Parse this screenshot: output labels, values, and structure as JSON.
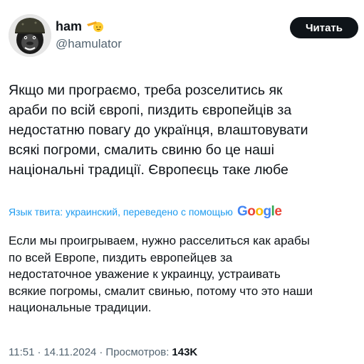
{
  "author": {
    "display_name": "ham",
    "handle": "@hamulator",
    "avatar_icon": "gorilla-avatar",
    "name_emoji": "saluting-face-emoji"
  },
  "follow_button": {
    "label": "Читать"
  },
  "tweet_text": "Якщо ми програємо, треба розселитись як\nараби по всій європі, пиздить європейців за\nнедостатню повагу до українця, влаштовувати\nвсякі погроми, смалить свиню бо це наші\nнаціональні традиції. Європеєць таке любе",
  "translation": {
    "label": "Язык твита: украинский, переведено с помощью",
    "provider_logo": "Google",
    "text": "Если мы проигрываем, нужно расселиться как арабы\nпо всей Европе, пиздить европейцев за\nнедостаточное уважение к украинцу, устраивать\nвсякие погромы, смалит свинью, потому что это наши\nнациональные традиции."
  },
  "meta": {
    "time": "11:51",
    "date": "14.11.2024",
    "views_label": "Просмотров:",
    "views_count": "143K"
  },
  "colors": {
    "link": "#1d9bf0",
    "secondary": "#536471",
    "button_bg": "#0f1419"
  }
}
